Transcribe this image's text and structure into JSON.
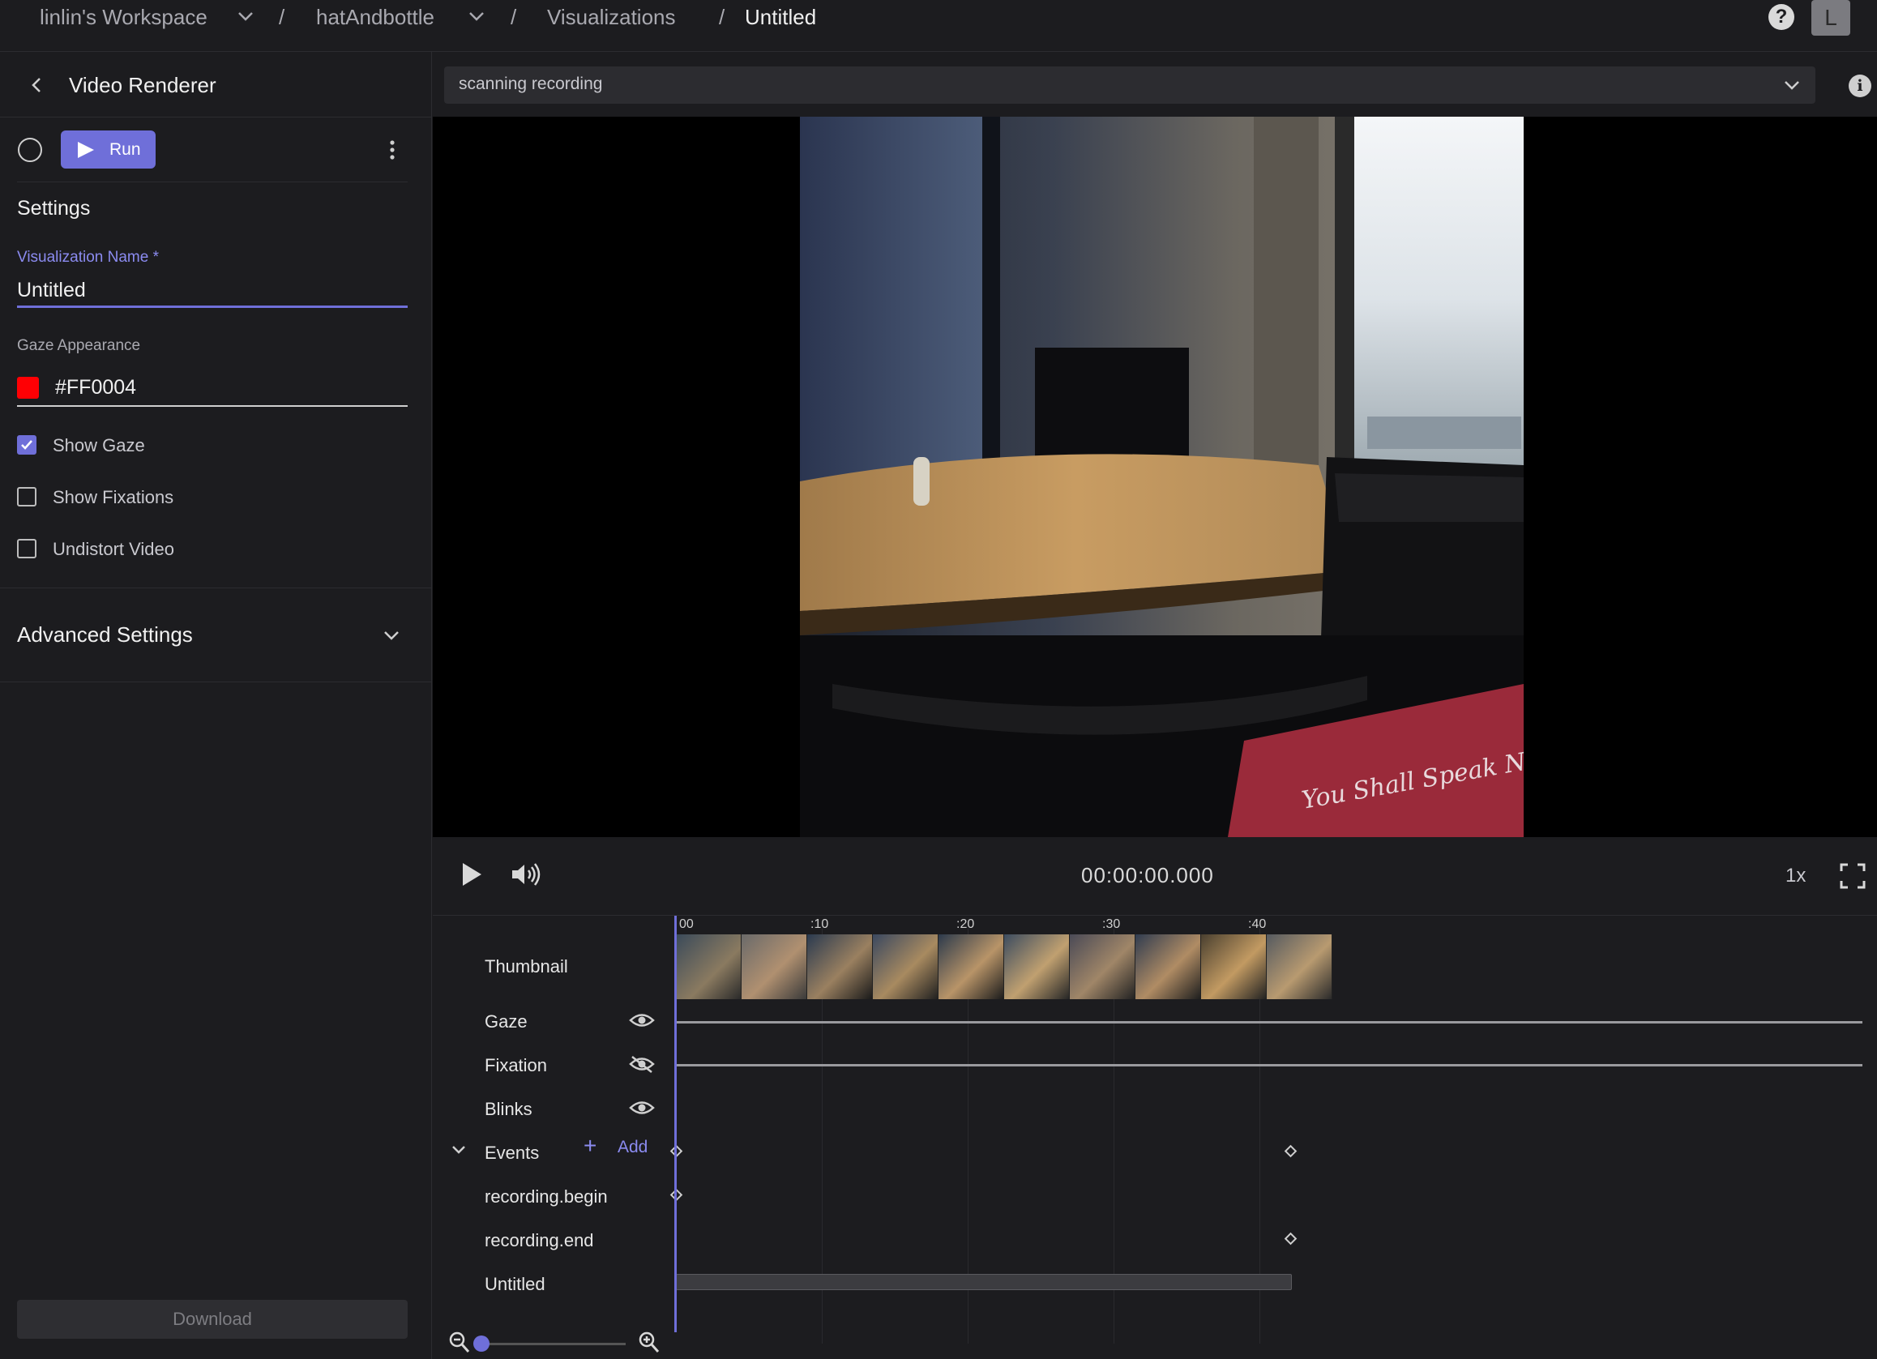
{
  "breadcrumb": {
    "workspace": "linlin's Workspace",
    "project": "hatAndbottle",
    "section": "Visualizations",
    "current": "Untitled",
    "separator": "/"
  },
  "header": {
    "help": "?",
    "avatar_initial": "L"
  },
  "panel": {
    "title": "Video Renderer",
    "run_label": "Run",
    "settings_title": "Settings",
    "viz_name_label": "Visualization Name *",
    "viz_name_value": "Untitled",
    "gaze_appearance_label": "Gaze Appearance",
    "gaze_color_value": "#FF0004",
    "checkboxes": [
      {
        "label": "Show Gaze",
        "checked": true
      },
      {
        "label": "Show Fixations",
        "checked": false
      },
      {
        "label": "Undistort Video",
        "checked": false
      }
    ],
    "advanced_settings": "Advanced Settings",
    "download_label": "Download"
  },
  "recording": {
    "selected": "scanning recording"
  },
  "player": {
    "timecode": "00:00:00.000",
    "speed": "1x"
  },
  "timeline": {
    "ticks": [
      "00",
      ":10",
      ":20",
      ":30",
      ":40"
    ],
    "tracks": {
      "thumbnail": "Thumbnail",
      "gaze": "Gaze",
      "fixation": "Fixation",
      "blinks": "Blinks",
      "events": "Events",
      "event_begin": "recording.begin",
      "event_end": "recording.end",
      "untitled": "Untitled"
    },
    "add_label": "Add",
    "zoom_level": 0.0
  },
  "colors": {
    "accent": "#6f6fd9",
    "gaze": "#FF0004",
    "background": "#1c1c1f"
  }
}
